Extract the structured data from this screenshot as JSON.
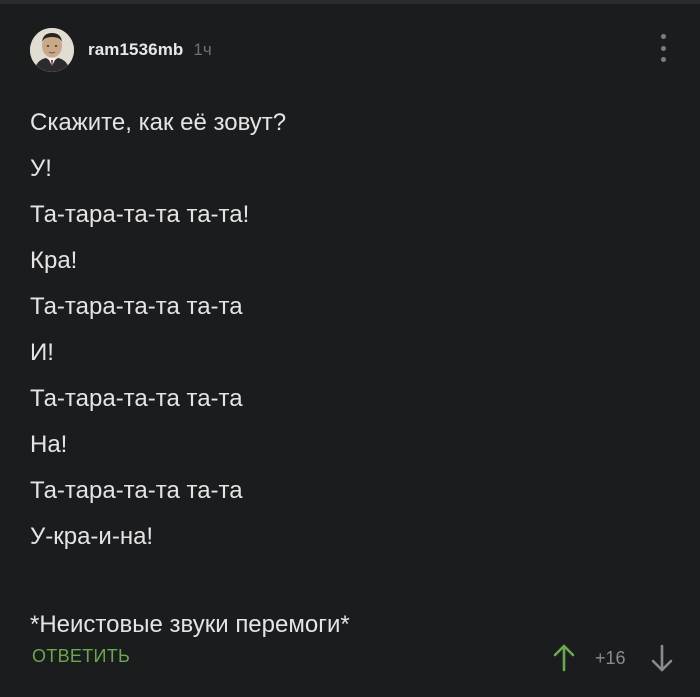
{
  "comment": {
    "author": "ram1536mb",
    "time": "1ч",
    "lines": [
      "Скажите, как её зовут?",
      "У!",
      "Та-тара-та-та та-та!",
      "Кра!",
      "Та-тара-та-та та-та",
      "И!",
      "Та-тара-та-та та-та",
      "На!",
      "Та-тара-та-та та-та",
      "У-кра-и-на!"
    ],
    "footnote": "*Неистовые звуки перемоги*",
    "reply_label": "ОТВЕТИТЬ",
    "score": "+16"
  },
  "icons": {
    "more": "more-vertical-icon",
    "up": "arrow-up-icon",
    "down": "arrow-down-icon"
  },
  "colors": {
    "background": "#1b1c1e",
    "text": "#e4e4e4",
    "reply": "#6aa84f",
    "muted": "#8a8b90"
  }
}
